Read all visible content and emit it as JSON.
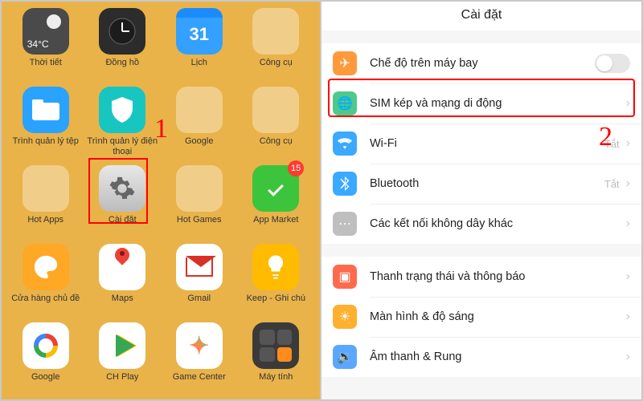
{
  "left": {
    "apps": [
      {
        "label": "Thời tiết",
        "temp": "34°C"
      },
      {
        "label": "Đồng hồ"
      },
      {
        "label": "Lịch",
        "day": "31"
      },
      {
        "label": "Công cụ"
      },
      {
        "label": "Trình quản lý tệp"
      },
      {
        "label": "Trình quản lý điện thoại"
      },
      {
        "label": "Google"
      },
      {
        "label": "Công cụ"
      },
      {
        "label": "Hot Apps"
      },
      {
        "label": "Cài đặt"
      },
      {
        "label": "Hot Games"
      },
      {
        "label": "App Market",
        "badge": "15"
      },
      {
        "label": "Cửa hàng chủ đề"
      },
      {
        "label": "Maps"
      },
      {
        "label": "Gmail"
      },
      {
        "label": "Keep - Ghi chú"
      },
      {
        "label": "Google"
      },
      {
        "label": "CH Play"
      },
      {
        "label": "Game Center"
      },
      {
        "label": "Máy tính"
      }
    ],
    "annotation": "1"
  },
  "right": {
    "title": "Cài đặt",
    "annotation": "2",
    "groups": [
      [
        {
          "label": "Chế độ trên máy bay",
          "icon": "airplane",
          "color": "#ff9a3c",
          "toggle": false
        },
        {
          "label": "SIM kép và mạng di động",
          "icon": "globe",
          "color": "#4fc98a",
          "chevron": true,
          "highlight": true
        },
        {
          "label": "Wi-Fi",
          "icon": "wifi",
          "color": "#3aa9ff",
          "status": "Tắt",
          "chevron": true
        },
        {
          "label": "Bluetooth",
          "icon": "bluetooth",
          "color": "#3aa9ff",
          "status": "Tắt",
          "chevron": true
        },
        {
          "label": "Các kết nối không dây khác",
          "icon": "dots",
          "color": "#bfbfbf",
          "chevron": true
        }
      ],
      [
        {
          "label": "Thanh trạng thái và thông báo",
          "icon": "bell",
          "color": "#ff6a4d",
          "chevron": true
        },
        {
          "label": "Màn hình & độ sáng",
          "icon": "sun",
          "color": "#ffb02e",
          "chevron": true
        },
        {
          "label": "Âm thanh & Rung",
          "icon": "sound",
          "color": "#5aa7ff",
          "chevron": true
        }
      ]
    ]
  }
}
